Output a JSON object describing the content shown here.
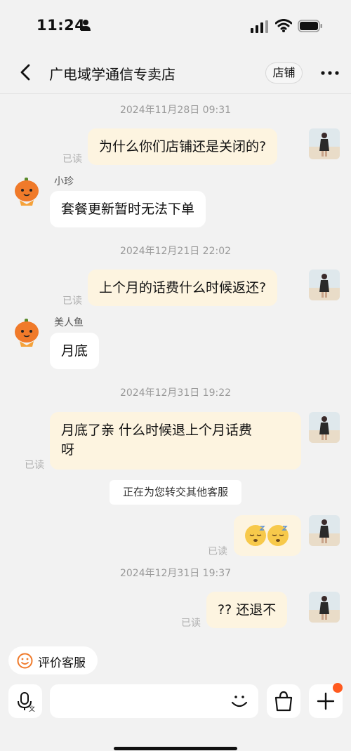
{
  "status_bar": {
    "time": "11:24"
  },
  "header": {
    "title": "广电域学通信专卖店",
    "store_button": "店铺"
  },
  "messages": {
    "ts1": "2024年11月28日 09:31",
    "m1": "为什么你们店铺还是关闭的?",
    "m1_read": "已读",
    "agent1_name": "小珍",
    "r1": "套餐更新暂时无法下单",
    "ts2": "2024年12月21日 22:02",
    "m2": "上个月的话费什么时候返还?",
    "m2_read": "已读",
    "agent2_name": "美人鱼",
    "r2": "月底",
    "ts3": "2024年12月31日 19:22",
    "m3_line1": "月底了亲 什么时候退上个月话费",
    "m3_line2": "呀",
    "m3_read": "已读",
    "transfer": "正在为您转交其他客服",
    "m4_read": "已读",
    "ts4": "2024年12月31日 19:37",
    "m5": "?? 还退不",
    "m5_read": "已读"
  },
  "footer": {
    "rate_label": "评价客服",
    "input_placeholder": ""
  },
  "colors": {
    "accent": "#f07a2a",
    "bubble_out": "#fdf4e0",
    "bubble_in": "#ffffff",
    "badge": "#ff5a1f"
  }
}
